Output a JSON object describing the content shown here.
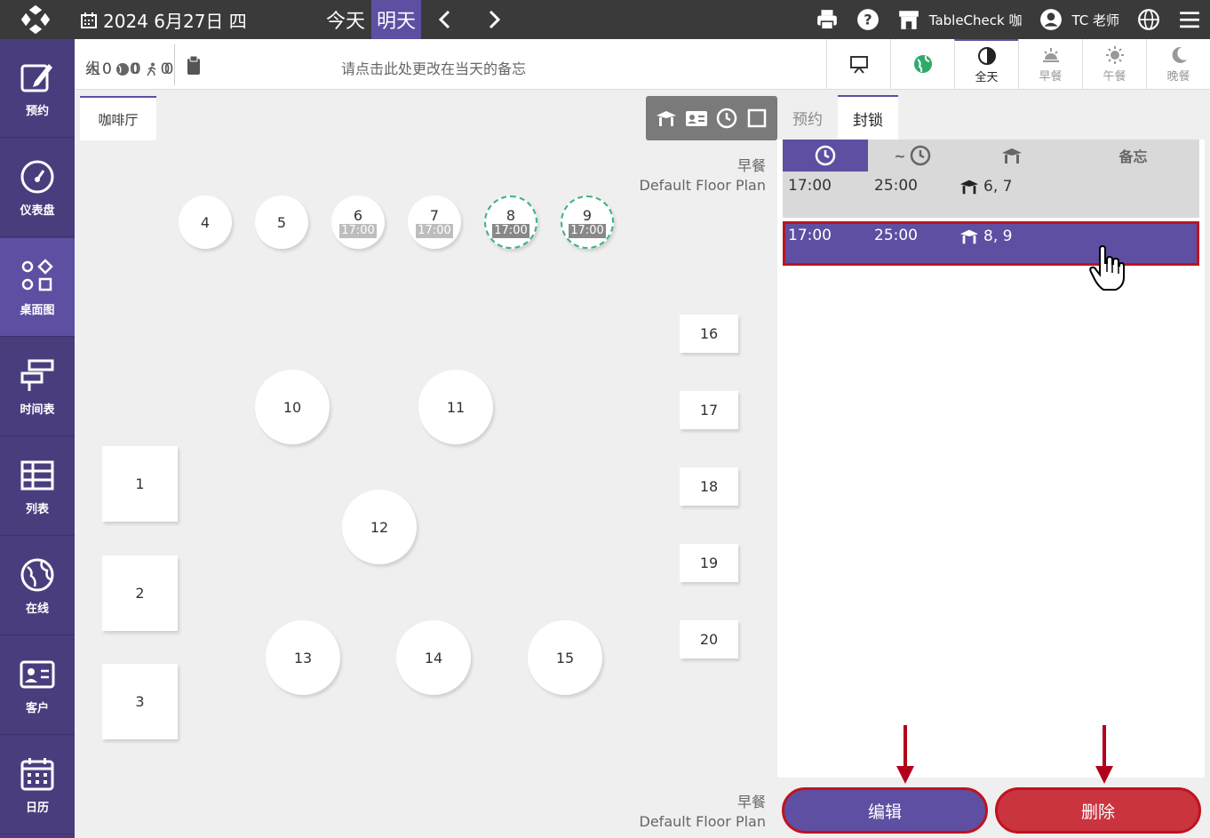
{
  "header": {
    "date": "2024 6月27日 四",
    "today_label": "今天",
    "tomorrow_label": "明天",
    "restaurant": "TableCheck 咖",
    "user": "TC 老师",
    "icons": [
      "printer-icon",
      "help-icon",
      "store-icon",
      "user-icon",
      "globe-icon",
      "menu-icon"
    ]
  },
  "sidebar": {
    "items": [
      {
        "label": "预约",
        "icon": "edit-icon"
      },
      {
        "label": "仪表盘",
        "icon": "dashboard-icon"
      },
      {
        "label": "桌面图",
        "icon": "shapes-icon",
        "active": true
      },
      {
        "label": "时间表",
        "icon": "timeline-icon"
      },
      {
        "label": "列表",
        "icon": "table-icon"
      },
      {
        "label": "在线",
        "icon": "globe-icon"
      },
      {
        "label": "客户",
        "icon": "contact-card-icon"
      },
      {
        "label": "日历",
        "icon": "calendar-icon"
      }
    ]
  },
  "subbar": {
    "counts": {
      "group_label": "组",
      "group_total": "0",
      "group_online": "0",
      "group_walkin": "0",
      "people_label": "人",
      "people_total": "0",
      "people_online": "0",
      "people_walkin": "0"
    },
    "memo_placeholder": "请点击此处更改在当天的备忘",
    "meal_periods": [
      {
        "label": "全天",
        "icon": "half-circle-icon",
        "active": true
      },
      {
        "label": "早餐",
        "icon": "sunrise-icon"
      },
      {
        "label": "午餐",
        "icon": "sun-icon"
      },
      {
        "label": "晚餐",
        "icon": "moon-icon"
      }
    ]
  },
  "floor": {
    "room_tab": "咖啡厅",
    "plan_meal": "早餐",
    "plan_name": "Default Floor Plan",
    "tables_top": [
      {
        "num": "4",
        "time": ""
      },
      {
        "num": "5",
        "time": ""
      },
      {
        "num": "6",
        "time": "17:00"
      },
      {
        "num": "7",
        "time": "17:00"
      },
      {
        "num": "8",
        "time": "17:00"
      },
      {
        "num": "9",
        "time": "17:00"
      }
    ],
    "tables_round": [
      "10",
      "11",
      "12",
      "13",
      "14",
      "15"
    ],
    "tables_square_left": [
      "1",
      "2",
      "3"
    ],
    "tables_square_right": [
      "16",
      "17",
      "18",
      "19",
      "20"
    ]
  },
  "panel": {
    "tabs": [
      {
        "label": "预约"
      },
      {
        "label": "封锁",
        "active": true
      }
    ],
    "columns": {
      "start_icon": "clock-icon",
      "end_prefix": "~",
      "table_icon": "table-icon",
      "memo": "备忘"
    },
    "rows": [
      {
        "start": "17:00",
        "end": "25:00",
        "tables": "6, 7",
        "memo": ""
      },
      {
        "start": "17:00",
        "end": "25:00",
        "tables": "8, 9",
        "memo": "",
        "selected": true
      }
    ],
    "edit_label": "编辑",
    "delete_label": "删除"
  },
  "colors": {
    "accent": "#5e4fa2",
    "sidebar": "#4a3d7e",
    "topbar": "#3a3a3a",
    "danger": "#c9343e",
    "highlight": "#c1121f"
  }
}
